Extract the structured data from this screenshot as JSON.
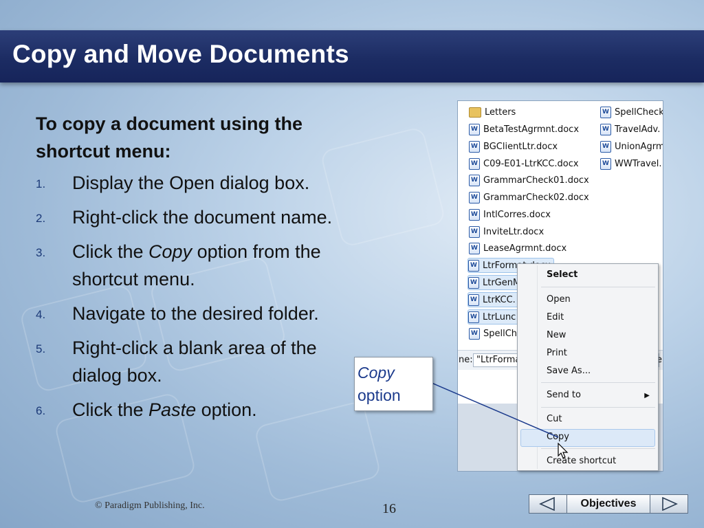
{
  "slide": {
    "title": "Copy and Move Documents",
    "heading": "To copy a document using the shortcut menu:",
    "steps": [
      {
        "num": "1.",
        "text": "Display the Open dialog box."
      },
      {
        "num": "2.",
        "text": "Right-click the document name."
      },
      {
        "num": "3.",
        "pre": "Click the ",
        "em": "Copy",
        "post": " option from the shortcut menu."
      },
      {
        "num": "4.",
        "text": "Navigate to the desired folder."
      },
      {
        "num": "5.",
        "text": "Right-click a blank area of the dialog box."
      },
      {
        "num": "6.",
        "pre": "Click the ",
        "em": "Paste",
        "post": " option."
      }
    ]
  },
  "screenshot": {
    "folder": "Letters",
    "files_col1": [
      "BetaTestAgrmnt.docx",
      "BGClientLtr.docx",
      "C09-E01-LtrKCC.docx",
      "GrammarCheck01.docx",
      "GrammarCheck02.docx",
      "IntlCorres.docx",
      "InviteLtr.docx",
      "LeaseAgrmnt.docx",
      "LtrFormat.docx",
      "LtrGenM",
      "LtrKCC.",
      "LtrLunc",
      "SpellCh"
    ],
    "files_col2": [
      "SpellCheck",
      "TravelAdv.",
      "UnionAgrm",
      "WWTravel."
    ],
    "filename_label": "ne:",
    "filename_value": "\"LtrForma",
    "filename_tail": "e"
  },
  "context_menu": {
    "select": "Select",
    "open": "Open",
    "edit": "Edit",
    "new": "New",
    "print": "Print",
    "save_as": "Save As...",
    "send_to": "Send to",
    "cut": "Cut",
    "copy": "Copy",
    "create_shortcut": "Create shortcut"
  },
  "callout": {
    "line1": "Copy",
    "line2": "option"
  },
  "footer": {
    "copyright": "© Paradigm Publishing, Inc.",
    "page": "16",
    "nav_label": "Objectives"
  }
}
